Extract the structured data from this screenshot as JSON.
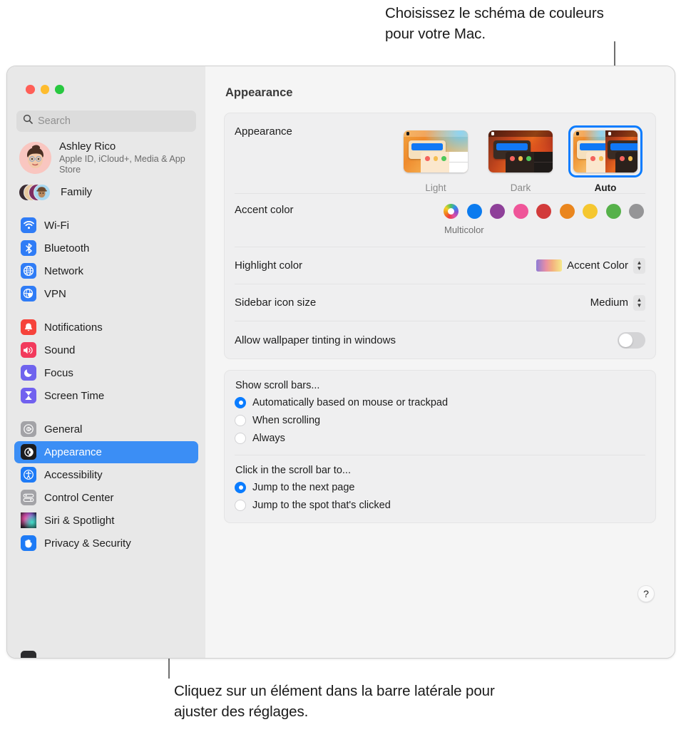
{
  "callouts": {
    "top": "Choisissez le schéma de couleurs pour votre Mac.",
    "bottom": "Cliquez sur un élément dans la barre latérale pour ajuster des réglages."
  },
  "window": {
    "traffic_lights": [
      "close-red",
      "minimize-yellow",
      "zoom-green"
    ],
    "search": {
      "placeholder": "Search",
      "value": "",
      "icon": "search-icon"
    }
  },
  "sidebar": {
    "account": {
      "name": "Ashley Rico",
      "subtitle": "Apple ID, iCloud+, Media & App Store",
      "avatar": "memoji-avatar"
    },
    "family": {
      "label": "Family",
      "icon": "family-avatars-icon"
    },
    "groups": [
      {
        "items": [
          {
            "label": "Wi-Fi",
            "icon": "wifi-icon",
            "color": "#2f7cf6",
            "selected": false
          },
          {
            "label": "Bluetooth",
            "icon": "bluetooth-icon",
            "color": "#2f7cf6",
            "selected": false
          },
          {
            "label": "Network",
            "icon": "network-globe-icon",
            "color": "#2f7cf6",
            "selected": false
          },
          {
            "label": "VPN",
            "icon": "vpn-globe-icon",
            "color": "#2f7cf6",
            "selected": false
          }
        ]
      },
      {
        "items": [
          {
            "label": "Notifications",
            "icon": "notifications-bell-icon",
            "color": "#f6433b",
            "selected": false
          },
          {
            "label": "Sound",
            "icon": "sound-speaker-icon",
            "color": "#f23a5c",
            "selected": false
          },
          {
            "label": "Focus",
            "icon": "focus-moon-icon",
            "color": "#6f63ee",
            "selected": false
          },
          {
            "label": "Screen Time",
            "icon": "screen-time-hourglass-icon",
            "color": "#7161ef",
            "selected": false
          }
        ]
      },
      {
        "items": [
          {
            "label": "General",
            "icon": "general-gear-icon",
            "color": "#8e8e93",
            "selected": false
          },
          {
            "label": "Appearance",
            "icon": "appearance-contrast-icon",
            "color": "#1c1c1e",
            "selected": true
          },
          {
            "label": "Accessibility",
            "icon": "accessibility-person-icon",
            "color": "#1e7bf6",
            "selected": false
          },
          {
            "label": "Control Center",
            "icon": "control-center-sliders-icon",
            "color": "#8e8e93",
            "selected": false
          },
          {
            "label": "Siri & Spotlight",
            "icon": "siri-orb-icon",
            "color": "#2b2b30",
            "selected": false
          },
          {
            "label": "Privacy & Security",
            "icon": "privacy-hand-icon",
            "color": "#1e7bf6",
            "selected": false
          }
        ]
      }
    ]
  },
  "main": {
    "title": "Appearance",
    "appearance": {
      "label": "Appearance",
      "options": [
        {
          "label": "Light",
          "selected": false
        },
        {
          "label": "Dark",
          "selected": false
        },
        {
          "label": "Auto",
          "selected": true
        }
      ]
    },
    "accent": {
      "label": "Accent color",
      "caption": "Multicolor",
      "selected_index": 0,
      "swatches": [
        {
          "name": "multicolor",
          "color": "multicolor",
          "selected": true
        },
        {
          "name": "blue",
          "color": "#0b7bef",
          "selected": false
        },
        {
          "name": "purple",
          "color": "#8e4099",
          "selected": false
        },
        {
          "name": "pink",
          "color": "#ef5599",
          "selected": false
        },
        {
          "name": "red",
          "color": "#d23b3b",
          "selected": false
        },
        {
          "name": "orange",
          "color": "#ea861e",
          "selected": false
        },
        {
          "name": "yellow",
          "color": "#f5c730",
          "selected": false
        },
        {
          "name": "green",
          "color": "#56b14a",
          "selected": false
        },
        {
          "name": "graphite",
          "color": "#959597",
          "selected": false
        }
      ]
    },
    "highlight": {
      "label": "Highlight color",
      "value": "Accent Color"
    },
    "sidebar_icon_size": {
      "label": "Sidebar icon size",
      "value": "Medium"
    },
    "wallpaper_tinting": {
      "label": "Allow wallpaper tinting in windows",
      "on": false
    },
    "show_scroll_bars": {
      "title": "Show scroll bars...",
      "options": [
        {
          "label": "Automatically based on mouse or trackpad",
          "selected": true
        },
        {
          "label": "When scrolling",
          "selected": false
        },
        {
          "label": "Always",
          "selected": false
        }
      ]
    },
    "click_scroll_bar": {
      "title": "Click in the scroll bar to...",
      "options": [
        {
          "label": "Jump to the next page",
          "selected": true
        },
        {
          "label": "Jump to the spot that's clicked",
          "selected": false
        }
      ]
    },
    "help_button": {
      "label": "?"
    }
  }
}
